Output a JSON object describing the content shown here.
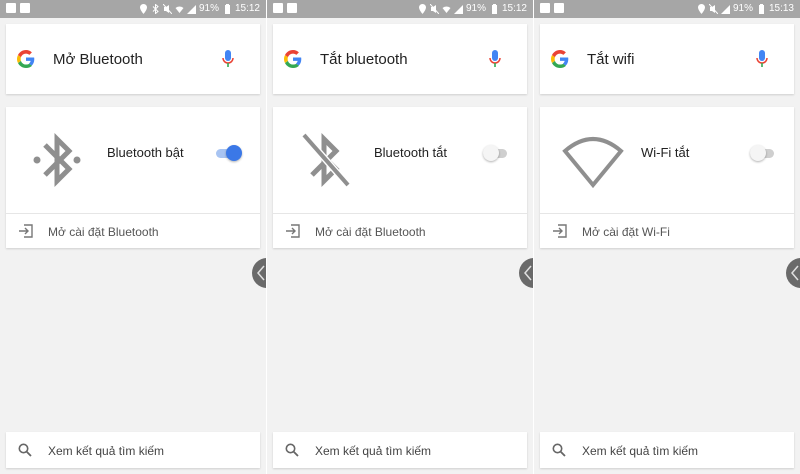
{
  "panels": [
    {
      "status": {
        "battery": "91%",
        "time": "15:12"
      },
      "query": "Mở Bluetooth",
      "result_label": "Bluetooth bật",
      "result_icon": "bluetooth-icon",
      "toggle_state": "on",
      "settings_link": "Mở cài đặt Bluetooth",
      "bottom_link": "Xem kết quả tìm kiếm"
    },
    {
      "status": {
        "battery": "91%",
        "time": "15:12"
      },
      "query": "Tắt bluetooth",
      "result_label": "Bluetooth tắt",
      "result_icon": "bluetooth-disabled-icon",
      "toggle_state": "off",
      "settings_link": "Mở cài đặt Bluetooth",
      "bottom_link": "Xem kết quả tìm kiếm"
    },
    {
      "status": {
        "battery": "91%",
        "time": "15:13"
      },
      "query": "Tắt wifi",
      "result_label": "Wi-Fi tắt",
      "result_icon": "wifi-off-icon",
      "toggle_state": "off",
      "settings_link": "Mở cài đặt Wi-Fi",
      "bottom_link": "Xem kết quả tìm kiếm"
    }
  ],
  "colors": {
    "accent_blue": "#3b78e7",
    "google_blue": "#4285f4",
    "google_red": "#ea4335",
    "google_yellow": "#fbbc05",
    "google_green": "#34a853",
    "background": "#f2f2f2",
    "statusbar": "#a6a6a6"
  }
}
